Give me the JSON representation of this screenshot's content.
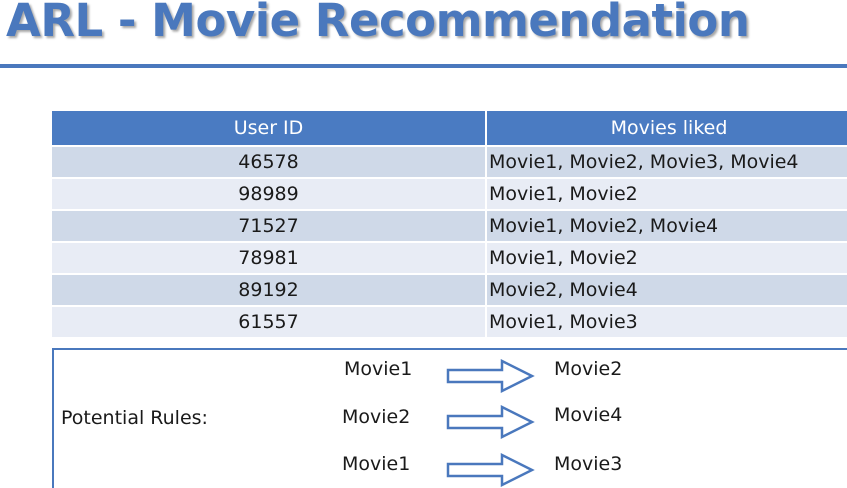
{
  "title": "ARL - Movie Recommendation",
  "colors": {
    "accent": "#4a78bd",
    "header_bg": "#4a7bc2",
    "row_dark": "#cfd9e8",
    "row_light": "#e8ecf5"
  },
  "table": {
    "headers": [
      "User ID",
      "Movies liked"
    ],
    "rows": [
      {
        "user_id": "46578",
        "movies": "Movie1, Movie2, Movie3, Movie4"
      },
      {
        "user_id": "98989",
        "movies": "Movie1, Movie2"
      },
      {
        "user_id": "71527",
        "movies": "Movie1, Movie2, Movie4"
      },
      {
        "user_id": "78981",
        "movies": "Movie1, Movie2"
      },
      {
        "user_id": "89192",
        "movies": "Movie2, Movie4"
      },
      {
        "user_id": "61557",
        "movies": "Movie1, Movie3"
      }
    ]
  },
  "rules": {
    "label": "Potential Rules:",
    "items": [
      {
        "from": "Movie1",
        "to": "Movie2",
        "icon": "right-arrow-icon"
      },
      {
        "from": "Movie2",
        "to": "Movie4",
        "icon": "right-arrow-icon"
      },
      {
        "from": "Movie1",
        "to": "Movie3",
        "icon": "right-arrow-icon"
      }
    ]
  }
}
